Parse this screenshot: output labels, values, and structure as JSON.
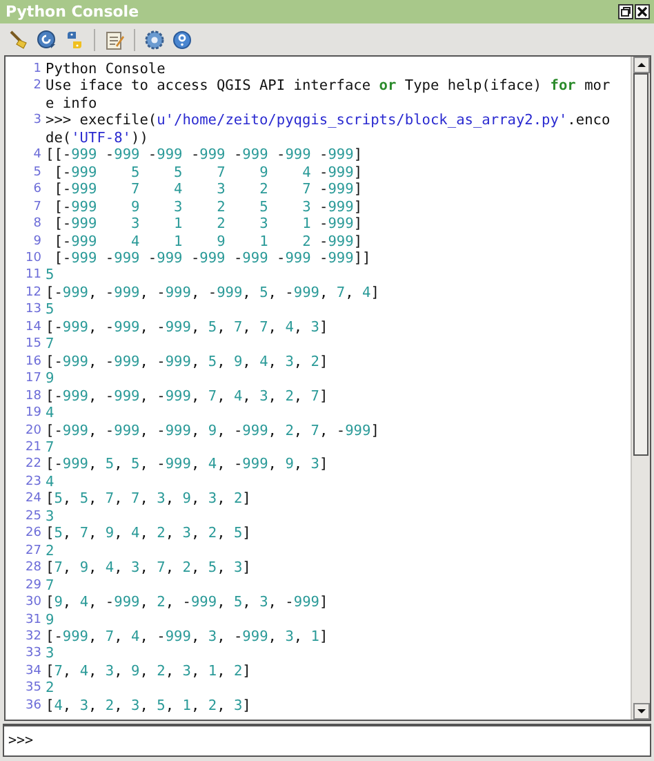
{
  "window": {
    "title": "Python Console"
  },
  "console": {
    "lines": [
      {
        "number": "1",
        "segments": [
          {
            "kind": "text",
            "text": "Python Console"
          }
        ]
      },
      {
        "number": "2",
        "segments": [
          {
            "kind": "text",
            "text": "Use iface to access QGIS API interface "
          },
          {
            "kind": "keyword",
            "text": "or"
          },
          {
            "kind": "text",
            "text": " Type help(iface) "
          },
          {
            "kind": "keyword",
            "text": "for"
          },
          {
            "kind": "text",
            "text": " more info"
          }
        ]
      },
      {
        "number": "3",
        "segments": [
          {
            "kind": "text",
            "text": ">>> execfile("
          },
          {
            "kind": "string",
            "text": "u'/home/zeito/pyqgis_scripts/block_as_array2.py'"
          },
          {
            "kind": "text",
            "text": ".encode("
          },
          {
            "kind": "string",
            "text": "'UTF-8'"
          },
          {
            "kind": "text",
            "text": "))"
          }
        ]
      },
      {
        "number": "4",
        "segments": [
          {
            "kind": "text",
            "text": "[[-999 -999 -999 -999 -999 -999 -999]"
          }
        ]
      },
      {
        "number": "5",
        "segments": [
          {
            "kind": "text",
            "text": " [-999    5    5    7    9    4 -999]"
          }
        ]
      },
      {
        "number": "6",
        "segments": [
          {
            "kind": "text",
            "text": " [-999    7    4    3    2    7 -999]"
          }
        ]
      },
      {
        "number": "7",
        "segments": [
          {
            "kind": "text",
            "text": " [-999    9    3    2    5    3 -999]"
          }
        ]
      },
      {
        "number": "8",
        "segments": [
          {
            "kind": "text",
            "text": " [-999    3    1    2    3    1 -999]"
          }
        ]
      },
      {
        "number": "9",
        "segments": [
          {
            "kind": "text",
            "text": " [-999    4    1    9    1    2 -999]"
          }
        ]
      },
      {
        "number": "10",
        "segments": [
          {
            "kind": "text",
            "text": " [-999 -999 -999 -999 -999 -999 -999]]"
          }
        ]
      },
      {
        "number": "11",
        "segments": [
          {
            "kind": "text",
            "text": "5"
          }
        ]
      },
      {
        "number": "12",
        "segments": [
          {
            "kind": "text",
            "text": "[-999, -999, -999, -999, 5, -999, 7, 4]"
          }
        ]
      },
      {
        "number": "13",
        "segments": [
          {
            "kind": "text",
            "text": "5"
          }
        ]
      },
      {
        "number": "14",
        "segments": [
          {
            "kind": "text",
            "text": "[-999, -999, -999, 5, 7, 7, 4, 3]"
          }
        ]
      },
      {
        "number": "15",
        "segments": [
          {
            "kind": "text",
            "text": "7"
          }
        ]
      },
      {
        "number": "16",
        "segments": [
          {
            "kind": "text",
            "text": "[-999, -999, -999, 5, 9, 4, 3, 2]"
          }
        ]
      },
      {
        "number": "17",
        "segments": [
          {
            "kind": "text",
            "text": "9"
          }
        ]
      },
      {
        "number": "18",
        "segments": [
          {
            "kind": "text",
            "text": "[-999, -999, -999, 7, 4, 3, 2, 7]"
          }
        ]
      },
      {
        "number": "19",
        "segments": [
          {
            "kind": "text",
            "text": "4"
          }
        ]
      },
      {
        "number": "20",
        "segments": [
          {
            "kind": "text",
            "text": "[-999, -999, -999, 9, -999, 2, 7, -999]"
          }
        ]
      },
      {
        "number": "21",
        "segments": [
          {
            "kind": "text",
            "text": "7"
          }
        ]
      },
      {
        "number": "22",
        "segments": [
          {
            "kind": "text",
            "text": "[-999, 5, 5, -999, 4, -999, 9, 3]"
          }
        ]
      },
      {
        "number": "23",
        "segments": [
          {
            "kind": "text",
            "text": "4"
          }
        ]
      },
      {
        "number": "24",
        "segments": [
          {
            "kind": "text",
            "text": "[5, 5, 7, 7, 3, 9, 3, 2]"
          }
        ]
      },
      {
        "number": "25",
        "segments": [
          {
            "kind": "text",
            "text": "3"
          }
        ]
      },
      {
        "number": "26",
        "segments": [
          {
            "kind": "text",
            "text": "[5, 7, 9, 4, 2, 3, 2, 5]"
          }
        ]
      },
      {
        "number": "27",
        "segments": [
          {
            "kind": "text",
            "text": "2"
          }
        ]
      },
      {
        "number": "28",
        "segments": [
          {
            "kind": "text",
            "text": "[7, 9, 4, 3, 7, 2, 5, 3]"
          }
        ]
      },
      {
        "number": "29",
        "segments": [
          {
            "kind": "text",
            "text": "7"
          }
        ]
      },
      {
        "number": "30",
        "segments": [
          {
            "kind": "text",
            "text": "[9, 4, -999, 2, -999, 5, 3, -999]"
          }
        ]
      },
      {
        "number": "31",
        "segments": [
          {
            "kind": "text",
            "text": "9"
          }
        ]
      },
      {
        "number": "32",
        "segments": [
          {
            "kind": "text",
            "text": "[-999, 7, 4, -999, 3, -999, 3, 1]"
          }
        ]
      },
      {
        "number": "33",
        "segments": [
          {
            "kind": "text",
            "text": "3"
          }
        ]
      },
      {
        "number": "34",
        "segments": [
          {
            "kind": "text",
            "text": "[7, 4, 3, 9, 2, 3, 1, 2]"
          }
        ]
      },
      {
        "number": "35",
        "segments": [
          {
            "kind": "text",
            "text": "2"
          }
        ]
      },
      {
        "number": "36",
        "segments": [
          {
            "kind": "text",
            "text": "[4, 3, 2, 3, 5, 1, 2, 3]"
          }
        ]
      }
    ]
  },
  "input": {
    "prompt": ">>>"
  }
}
